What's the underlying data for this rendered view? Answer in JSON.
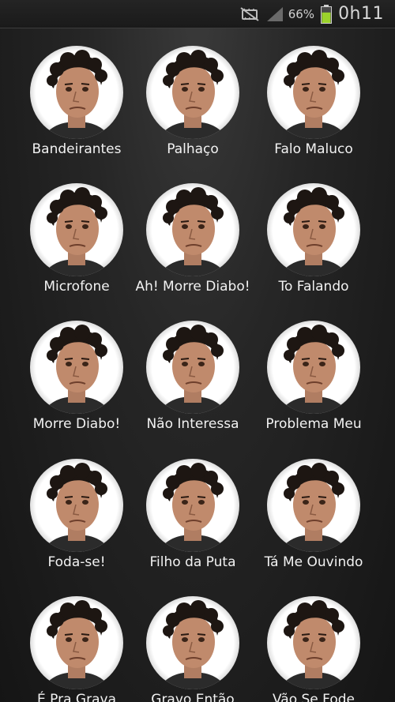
{
  "status_bar": {
    "icons": [
      "mute-icon",
      "signal-icon",
      "battery-icon"
    ],
    "battery_percent": "66%",
    "time": "0h11",
    "battery_color": "#9bd22b"
  },
  "sounds": [
    {
      "label": "Bandeirantes"
    },
    {
      "label": "Palhaço"
    },
    {
      "label": "Falo Maluco"
    },
    {
      "label": "Microfone"
    },
    {
      "label": "Ah! Morre Diabo!"
    },
    {
      "label": "To Falando"
    },
    {
      "label": "Morre Diabo!"
    },
    {
      "label": "Não Interessa"
    },
    {
      "label": "Problema Meu"
    },
    {
      "label": "Foda-se!"
    },
    {
      "label": "Filho da Puta"
    },
    {
      "label": "Tá Me Ouvindo"
    },
    {
      "label": "É Pra Grava"
    },
    {
      "label": "Gravo Então"
    },
    {
      "label": "Vão Se Fode"
    }
  ]
}
